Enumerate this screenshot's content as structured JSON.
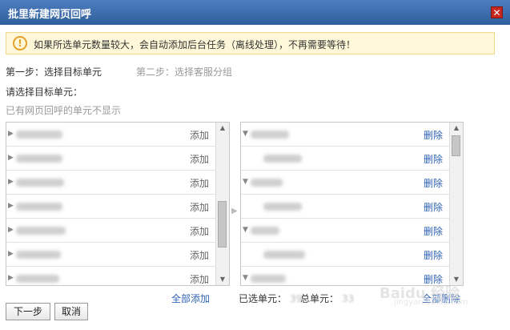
{
  "dialog": {
    "title": "批里新建网页回呼",
    "close_icon": "close-icon"
  },
  "notice": {
    "icon": "warning-icon",
    "text": "如果所选单元数量较大，会自动添加后台任务（离线处理），不再需要等待！"
  },
  "steps": {
    "step1": "第一步：选择目标单元",
    "step2": "第二步：选择客服分组"
  },
  "select_label": "请选择目标单元：",
  "hint": "已有网页回呼的单元不显示",
  "left_list": {
    "items": [
      {
        "action": "添加"
      },
      {
        "action": "添加"
      },
      {
        "action": "添加"
      },
      {
        "action": "添加"
      },
      {
        "action": "添加"
      },
      {
        "action": "添加"
      },
      {
        "action": "添加"
      }
    ],
    "add_all": "全部添加"
  },
  "right_list": {
    "items": [
      {
        "action": "删除"
      },
      {
        "action": "删除"
      },
      {
        "action": "删除"
      },
      {
        "action": "删除"
      },
      {
        "action": "删除"
      },
      {
        "action": "删除"
      },
      {
        "action": "删除"
      }
    ],
    "selected_label": "已选单元：",
    "selected_value": "39",
    "total_label": "总单元：",
    "total_value": "33",
    "delete_all": "全部删除"
  },
  "buttons": {
    "next": "下一步",
    "cancel": "取消"
  },
  "watermark": {
    "text": "Baidu 经验",
    "sub": "jingyan.baidu.com"
  },
  "colors": {
    "titlebar": "#2f5f9a",
    "link": "#2f63b3",
    "notice_bg": "#fff8d8",
    "close": "#c8251c"
  }
}
